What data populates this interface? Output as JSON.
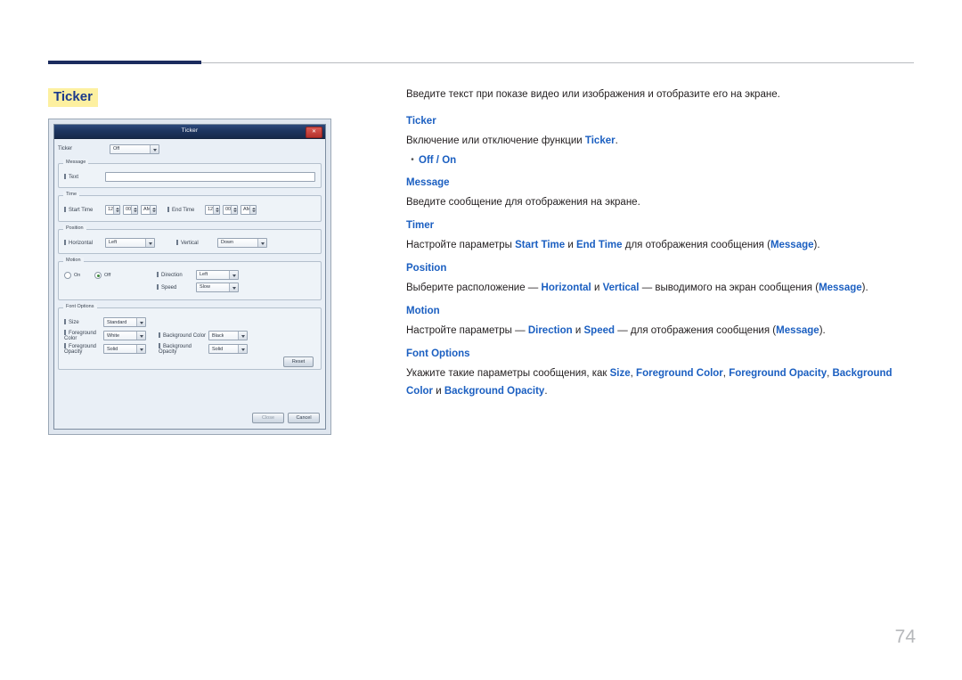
{
  "section": {
    "title": "Ticker"
  },
  "page": {
    "number": "74"
  },
  "doc": {
    "lead": "Введите текст при показе видео или изображения и отобразите его на экране.",
    "ticker_head": "Ticker",
    "ticker_body_1": "Включение или отключение функции ",
    "ticker_body_kw": "Ticker",
    "ticker_body_2": ".",
    "bullet_offon": "Off / On",
    "message_head": "Message",
    "message_body": "Введите сообщение для отображения на экране.",
    "timer_head": "Timer",
    "timer_body_1": "Настройте параметры ",
    "timer_kw_start": "Start Time",
    "timer_body_2": " и ",
    "timer_kw_end": "End Time",
    "timer_body_3": " для отображения сообщения (",
    "timer_kw_msg": "Message",
    "timer_body_4": ").",
    "position_head": "Position",
    "position_body_1": "Выберите расположение — ",
    "position_kw_h": "Horizontal",
    "position_body_2": " и ",
    "position_kw_v": "Vertical",
    "position_body_3": " — выводимого на экран сообщения (",
    "position_kw_msg": "Message",
    "position_body_4": ").",
    "motion_head": "Motion",
    "motion_body_1": "Настройте параметры — ",
    "motion_kw_dir": "Direction",
    "motion_body_2": " и ",
    "motion_kw_speed": "Speed",
    "motion_body_3": " — для отображения сообщения (",
    "motion_kw_msg": "Message",
    "motion_body_4": ").",
    "font_head": "Font Options",
    "font_body_1": "Укажите такие параметры сообщения, как ",
    "font_kw_size": "Size",
    "font_body_2": ", ",
    "font_kw_fgcolor": "Foreground Color",
    "font_body_3": ", ",
    "font_kw_fgopacity": "Foreground Opacity",
    "font_body_4": ", ",
    "font_kw_bgcolor": "Background Color",
    "font_body_5": " и ",
    "font_kw_bgopacity": "Background Opacity",
    "font_body_6": "."
  },
  "dialog": {
    "title": "Ticker",
    "close_label": "✕",
    "ticker_label": "Ticker",
    "ticker_value": "Off",
    "message_group": "Message",
    "message_label": "Text",
    "message_value": "",
    "time_group": "Time",
    "start_time_label": "Start Time",
    "start_hour": "12",
    "start_minute": "00",
    "start_ampm": "AM",
    "end_time_label": "End Time",
    "end_hour": "12",
    "end_minute": "00",
    "end_ampm": "AM",
    "position_group": "Position",
    "horizontal_label": "Horizontal",
    "horizontal_value": "Left",
    "vertical_label": "Vertical",
    "vertical_value": "Down",
    "motion_group": "Motion",
    "motion_on": "On",
    "motion_off": "Off",
    "direction_label": "Direction",
    "direction_value": "Left",
    "speed_label": "Speed",
    "speed_value": "Slow",
    "font_group": "Font Options",
    "size_label": "Size",
    "size_value": "Standard",
    "foreground_color_label": "Foreground Color",
    "foreground_color_value": "White",
    "background_color_label": "Background Color",
    "background_color_value": "Black",
    "foreground_opacity_label": "Foreground Opacity",
    "foreground_opacity_value": "Solid",
    "background_opacity_label": "Background Opacity",
    "background_opacity_value": "Solid",
    "reset_label": "Reset",
    "close_btn_label": "Close",
    "cancel_btn_label": "Cancel"
  }
}
